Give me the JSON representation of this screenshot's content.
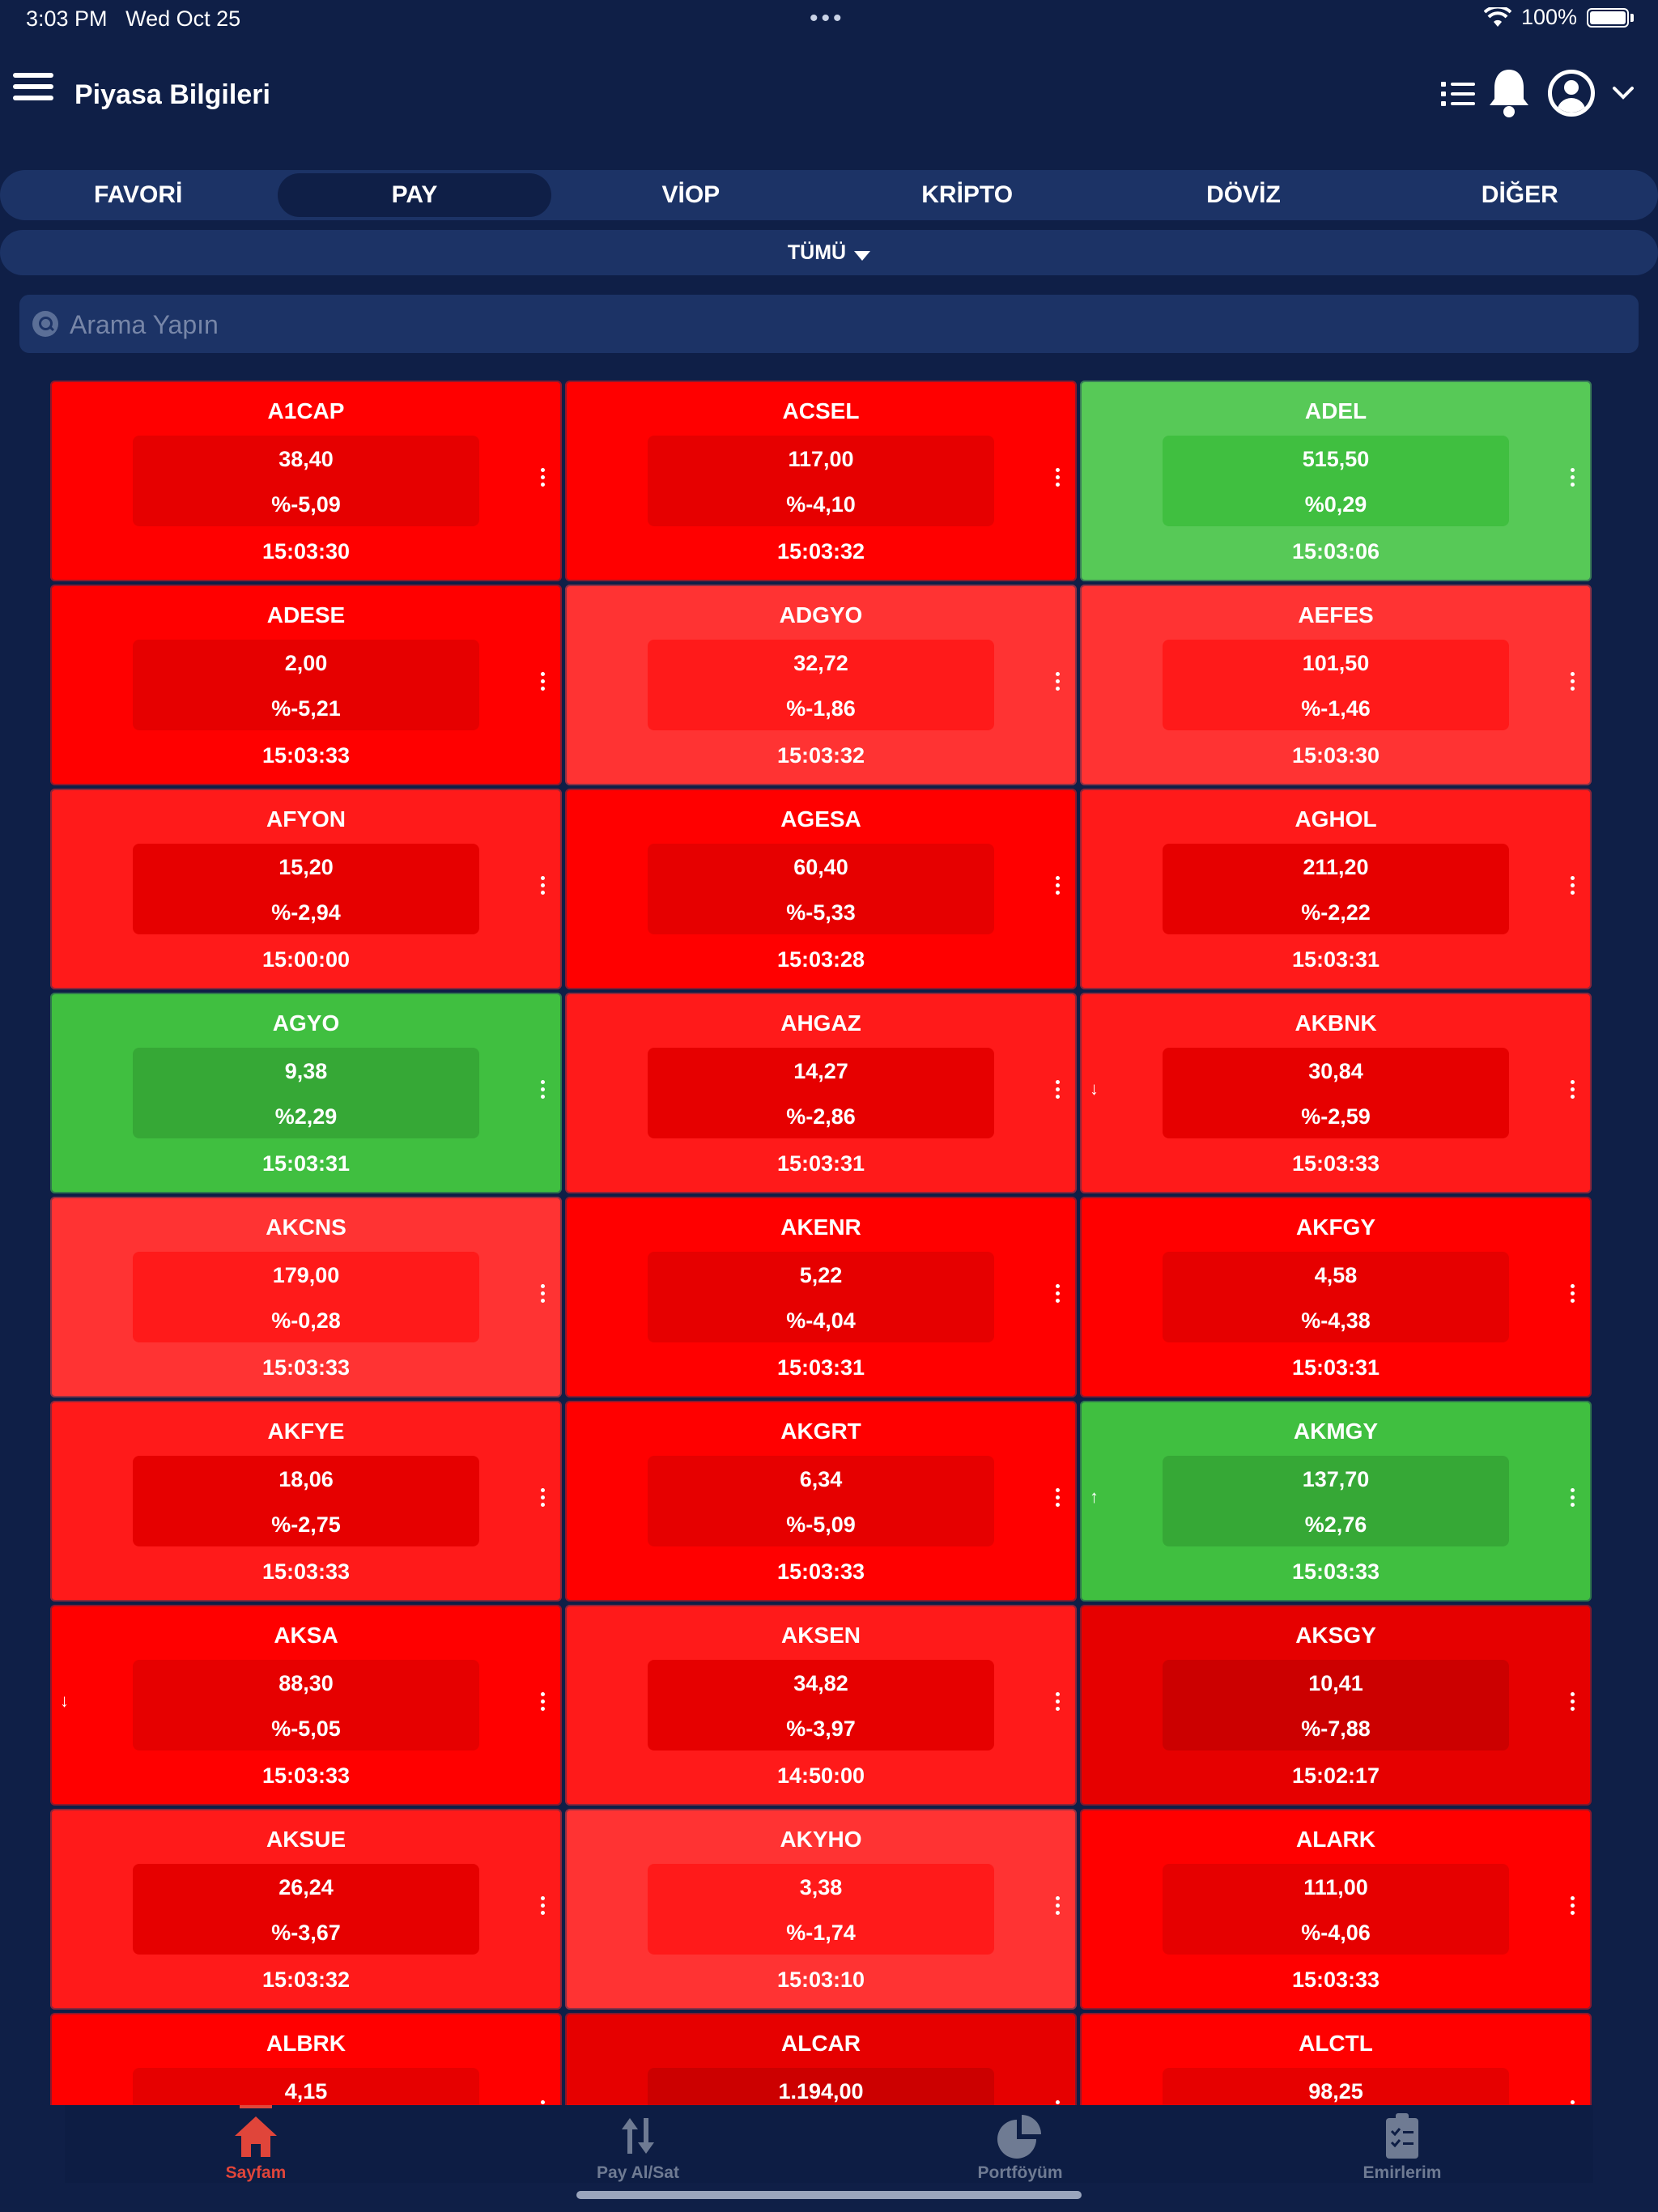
{
  "status_bar": {
    "time": "3:03 PM",
    "date": "Wed Oct 25",
    "battery": "100%"
  },
  "header": {
    "title": "Piyasa Bilgileri"
  },
  "tabs": [
    {
      "label": "FAVORİ",
      "active": false
    },
    {
      "label": "PAY",
      "active": true
    },
    {
      "label": "VİOP",
      "active": false
    },
    {
      "label": "KRİPTO",
      "active": false
    },
    {
      "label": "DÖVİZ",
      "active": false
    },
    {
      "label": "DİĞER",
      "active": false
    }
  ],
  "filter": {
    "label": "TÜMÜ"
  },
  "search": {
    "placeholder": "Arama Yapın",
    "value": ""
  },
  "colors": {
    "background": "#0f1f47",
    "bar": "#1c3366",
    "red": "#ff0000",
    "red_light": "#ff3333",
    "red_mid": "#ff1a1a",
    "red_dark": "#e60000",
    "green_light": "#57c957",
    "green": "#40bf40",
    "nav_active": "#e0453a"
  },
  "stocks": [
    {
      "symbol": "A1CAP",
      "price": "38,40",
      "change": "%-5,09",
      "time": "15:03:30",
      "tone": "c1",
      "arrow": ""
    },
    {
      "symbol": "ACSEL",
      "price": "117,00",
      "change": "%-4,10",
      "time": "15:03:32",
      "tone": "c1",
      "arrow": ""
    },
    {
      "symbol": "ADEL",
      "price": "515,50",
      "change": "%0,29",
      "time": "15:03:06",
      "tone": "g1",
      "arrow": ""
    },
    {
      "symbol": "ADESE",
      "price": "2,00",
      "change": "%-5,21",
      "time": "15:03:33",
      "tone": "c1",
      "arrow": ""
    },
    {
      "symbol": "ADGYO",
      "price": "32,72",
      "change": "%-1,86",
      "time": "15:03:32",
      "tone": "c2",
      "arrow": ""
    },
    {
      "symbol": "AEFES",
      "price": "101,50",
      "change": "%-1,46",
      "time": "15:03:30",
      "tone": "c2",
      "arrow": ""
    },
    {
      "symbol": "AFYON",
      "price": "15,20",
      "change": "%-2,94",
      "time": "15:00:00",
      "tone": "c3",
      "arrow": ""
    },
    {
      "symbol": "AGESA",
      "price": "60,40",
      "change": "%-5,33",
      "time": "15:03:28",
      "tone": "c1",
      "arrow": ""
    },
    {
      "symbol": "AGHOL",
      "price": "211,20",
      "change": "%-2,22",
      "time": "15:03:31",
      "tone": "c3",
      "arrow": ""
    },
    {
      "symbol": "AGYO",
      "price": "9,38",
      "change": "%2,29",
      "time": "15:03:31",
      "tone": "g2",
      "arrow": ""
    },
    {
      "symbol": "AHGAZ",
      "price": "14,27",
      "change": "%-2,86",
      "time": "15:03:31",
      "tone": "c3",
      "arrow": ""
    },
    {
      "symbol": "AKBNK",
      "price": "30,84",
      "change": "%-2,59",
      "time": "15:03:33",
      "tone": "c3",
      "arrow": "↓"
    },
    {
      "symbol": "AKCNS",
      "price": "179,00",
      "change": "%-0,28",
      "time": "15:03:33",
      "tone": "c2",
      "arrow": ""
    },
    {
      "symbol": "AKENR",
      "price": "5,22",
      "change": "%-4,04",
      "time": "15:03:31",
      "tone": "c1",
      "arrow": ""
    },
    {
      "symbol": "AKFGY",
      "price": "4,58",
      "change": "%-4,38",
      "time": "15:03:31",
      "tone": "c1",
      "arrow": ""
    },
    {
      "symbol": "AKFYE",
      "price": "18,06",
      "change": "%-2,75",
      "time": "15:03:33",
      "tone": "c3",
      "arrow": ""
    },
    {
      "symbol": "AKGRT",
      "price": "6,34",
      "change": "%-5,09",
      "time": "15:03:33",
      "tone": "c1",
      "arrow": ""
    },
    {
      "symbol": "AKMGY",
      "price": "137,70",
      "change": "%2,76",
      "time": "15:03:33",
      "tone": "g2",
      "arrow": "↑"
    },
    {
      "symbol": "AKSA",
      "price": "88,30",
      "change": "%-5,05",
      "time": "15:03:33",
      "tone": "c1",
      "arrow": "↓"
    },
    {
      "symbol": "AKSEN",
      "price": "34,82",
      "change": "%-3,97",
      "time": "14:50:00",
      "tone": "c3",
      "arrow": ""
    },
    {
      "symbol": "AKSGY",
      "price": "10,41",
      "change": "%-7,88",
      "time": "15:02:17",
      "tone": "c4",
      "arrow": ""
    },
    {
      "symbol": "AKSUE",
      "price": "26,24",
      "change": "%-3,67",
      "time": "15:03:32",
      "tone": "c3",
      "arrow": ""
    },
    {
      "symbol": "AKYHO",
      "price": "3,38",
      "change": "%-1,74",
      "time": "15:03:10",
      "tone": "c2",
      "arrow": ""
    },
    {
      "symbol": "ALARK",
      "price": "111,00",
      "change": "%-4,06",
      "time": "15:03:33",
      "tone": "c1",
      "arrow": ""
    },
    {
      "symbol": "ALBRK",
      "price": "4,15",
      "change": "",
      "time": "",
      "tone": "c1",
      "arrow": ""
    },
    {
      "symbol": "ALCAR",
      "price": "1.194,00",
      "change": "",
      "time": "",
      "tone": "c4",
      "arrow": ""
    },
    {
      "symbol": "ALCTL",
      "price": "98,25",
      "change": "",
      "time": "",
      "tone": "c1",
      "arrow": ""
    }
  ],
  "bottom_nav": [
    {
      "label": "Sayfam",
      "icon": "home-icon",
      "active": true
    },
    {
      "label": "Pay Al/Sat",
      "icon": "swap-icon",
      "active": false
    },
    {
      "label": "Portföyüm",
      "icon": "pie-chart-icon",
      "active": false
    },
    {
      "label": "Emirlerim",
      "icon": "clipboard-icon",
      "active": false
    }
  ]
}
